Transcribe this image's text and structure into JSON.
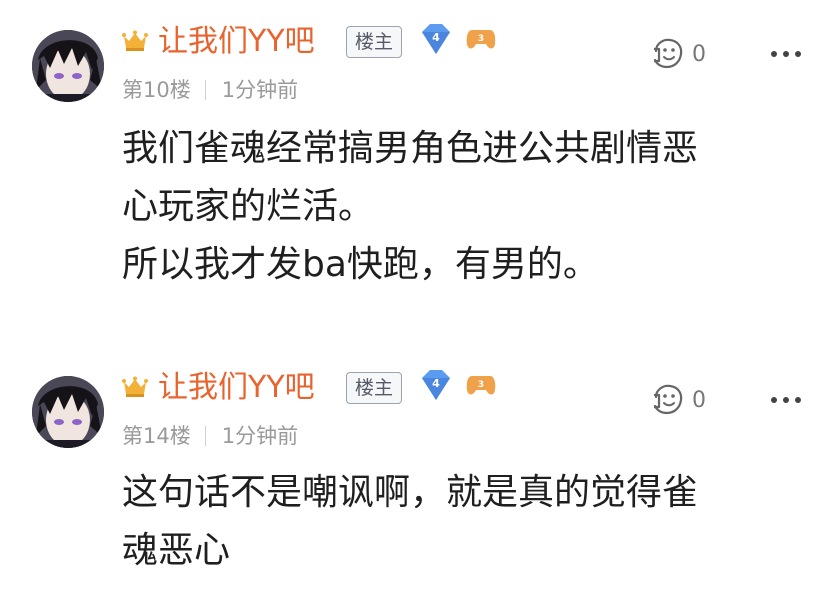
{
  "posts": [
    {
      "username": "让我们YY吧",
      "badge": "楼主",
      "level": "4",
      "floor": "第10楼",
      "time": "1分钟前",
      "likes": "0",
      "lines": [
        "我们雀魂经常搞男角色进公共剧情恶",
        "心玩家的烂活。",
        "所以我才发ba快跑，有男的。"
      ]
    },
    {
      "username": "让我们YY吧",
      "badge": "楼主",
      "level": "4",
      "floor": "第14楼",
      "time": "1分钟前",
      "likes": "0",
      "lines": [
        "这句话不是嘲讽啊，就是真的觉得雀",
        "魂恶心"
      ]
    }
  ],
  "icons": {
    "crown": "crown-icon",
    "level": "diamond-level-icon",
    "game": "gamepad-badge-icon",
    "like": "like-face-icon",
    "more": "more-dots-icon"
  },
  "colors": {
    "username": "#e8632d",
    "meta": "#9a9a9a",
    "gem": "#5b9cf0",
    "game_badge": "#f0a24a"
  }
}
